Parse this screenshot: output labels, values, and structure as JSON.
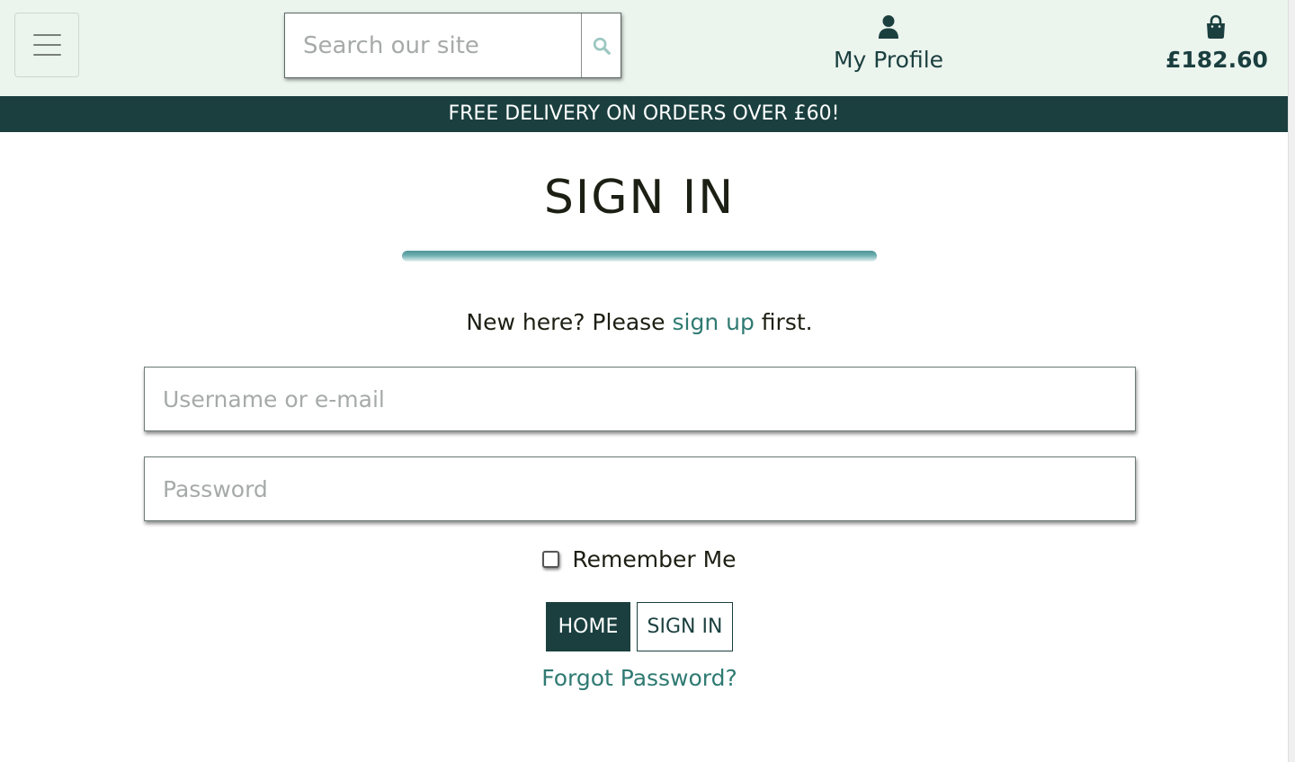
{
  "header": {
    "search_placeholder": "Search our site",
    "profile_label": "My Profile",
    "bag_total": "£182.60"
  },
  "banner": {
    "text": "FREE DELIVERY ON ORDERS OVER £60!"
  },
  "signin": {
    "title": "SIGN IN",
    "intro_before": "New here? Please ",
    "intro_link": "sign up",
    "intro_after": " first.",
    "username_placeholder": "Username or e-mail",
    "password_placeholder": "Password",
    "remember_label": "Remember Me",
    "home_button": "HOME",
    "signin_button": "SIGN IN",
    "forgot_link": "Forgot Password?"
  },
  "colors": {
    "header_bg": "#ecf4ee",
    "brand_dark": "#1b3f3f",
    "link": "#2f7a72"
  },
  "icons": {
    "menu": "hamburger-menu-icon",
    "search": "search-icon",
    "profile": "user-icon",
    "bag": "shopping-bag-icon"
  }
}
